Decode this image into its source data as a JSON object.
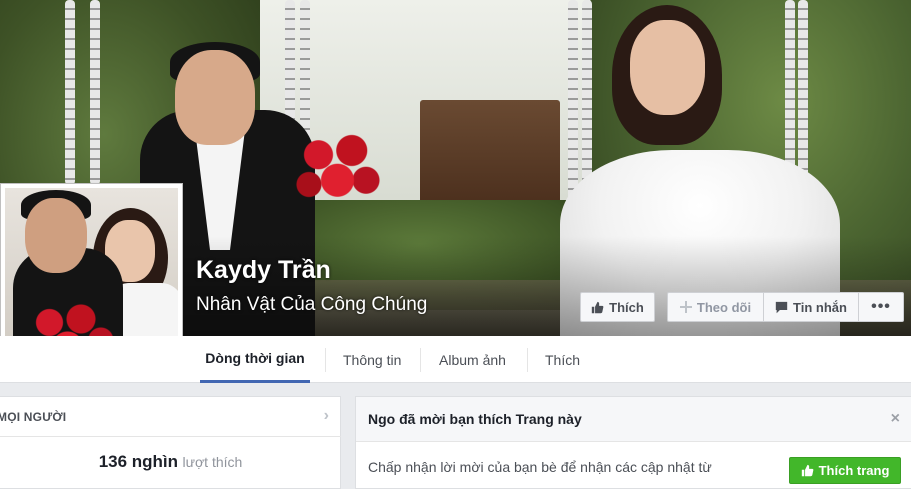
{
  "page": {
    "name": "Kaydy Trần",
    "category": "Nhân Vật Của Công Chúng"
  },
  "actions": {
    "like_label": "Thích",
    "follow_label": "Theo dõi",
    "message_label": "Tin nhắn",
    "more_label": "•••"
  },
  "tabs": [
    {
      "label": "Dòng thời gian",
      "active": true
    },
    {
      "label": "Thông tin"
    },
    {
      "label": "Album ảnh"
    },
    {
      "label": "Thích"
    }
  ],
  "left_card": {
    "header": "MỌI NGƯỜI",
    "likes_count": "136 nghìn",
    "likes_label": "lượt thích"
  },
  "invite": {
    "title": "Ngo đã mời bạn thích Trang này",
    "body": "Chấp nhận lời mời của bạn bè để nhận các cập nhật từ",
    "button_label": "Thích trang",
    "close_symbol": "×"
  },
  "icons": {
    "like": "thumbs-up-icon",
    "follow": "plus-icon",
    "message": "chat-bubble-icon",
    "more": "more-dots-icon",
    "chevron": "chevron-right-icon"
  },
  "colors": {
    "accent": "#4267b2",
    "like_button": "#42b72a",
    "background": "#e9ebee"
  }
}
